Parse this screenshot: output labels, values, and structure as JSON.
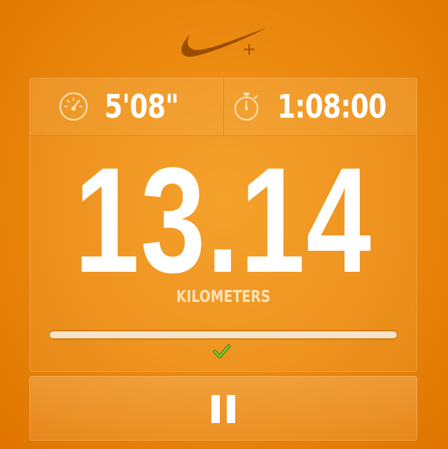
{
  "header": {
    "logo_icon": "nike-plus-swoosh-icon",
    "logo_symbol": "+"
  },
  "stats": {
    "pace": {
      "icon": "speedometer-icon",
      "value": "5'08\""
    },
    "duration": {
      "icon": "stopwatch-icon",
      "value": "1:08:00"
    }
  },
  "distance": {
    "value": "13.14",
    "unit": "KILOMETERS"
  },
  "progress": {
    "fraction": 1.0,
    "complete_icon": "checkmark-icon"
  },
  "controls": {
    "pause_icon": "pause-icon"
  },
  "colors": {
    "background": "#ec8a10",
    "swoosh": "#9a4d00",
    "text": "#ffffff",
    "unit_text": "#fde2b8",
    "icon_stroke": "#fde0b0",
    "check": "#5aa31e"
  }
}
